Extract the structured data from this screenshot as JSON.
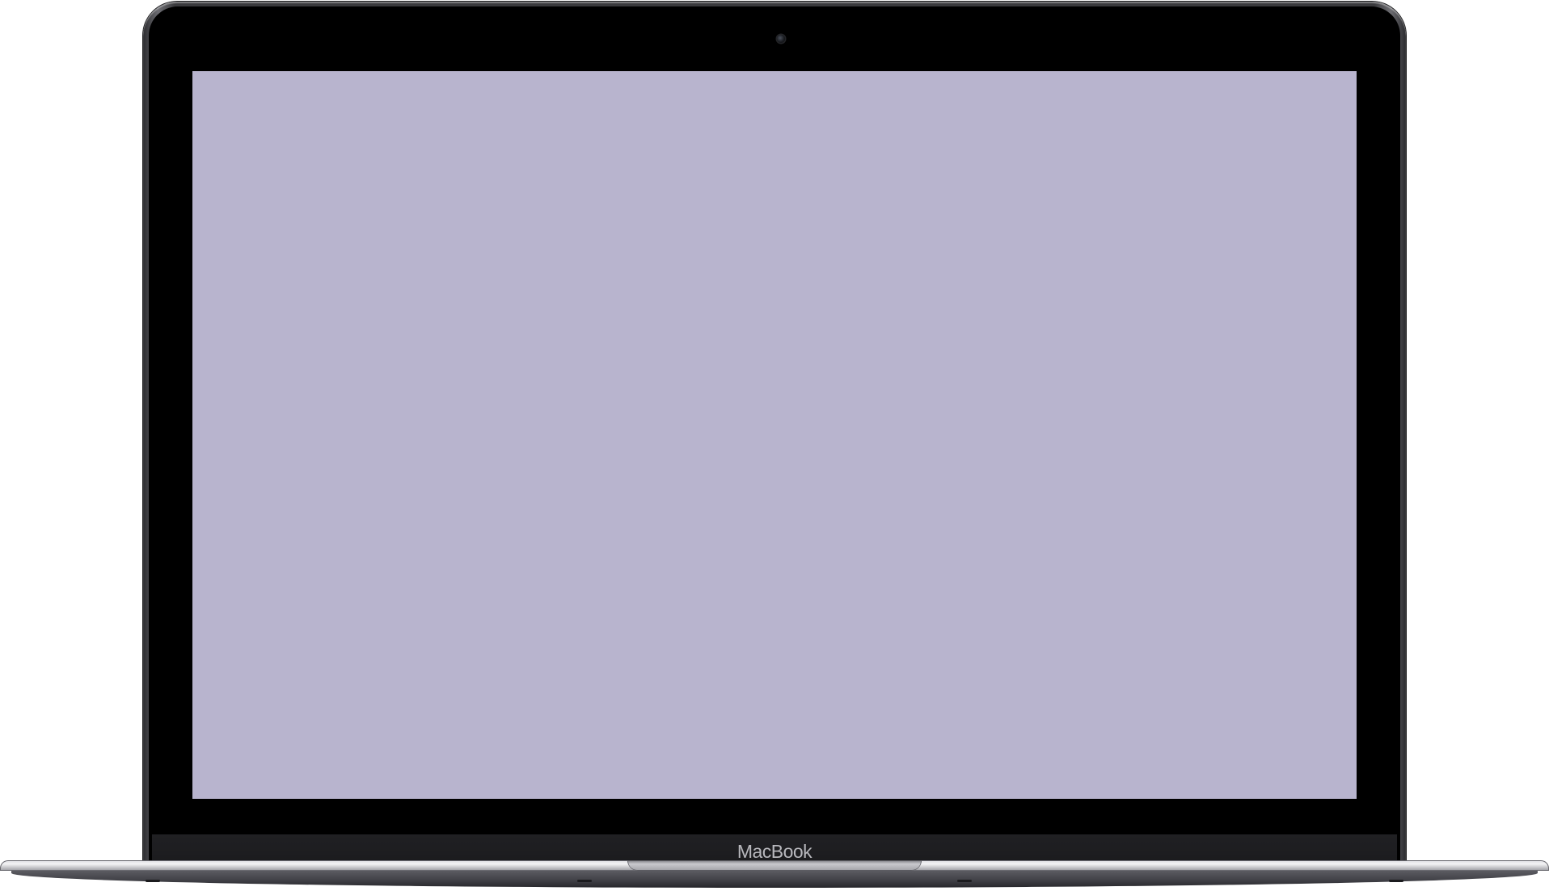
{
  "device": {
    "brand_label": "MacBook",
    "screen_color": "#b8b4ce",
    "bezel_color": "#000000",
    "body_color": "#3a3a3d"
  }
}
